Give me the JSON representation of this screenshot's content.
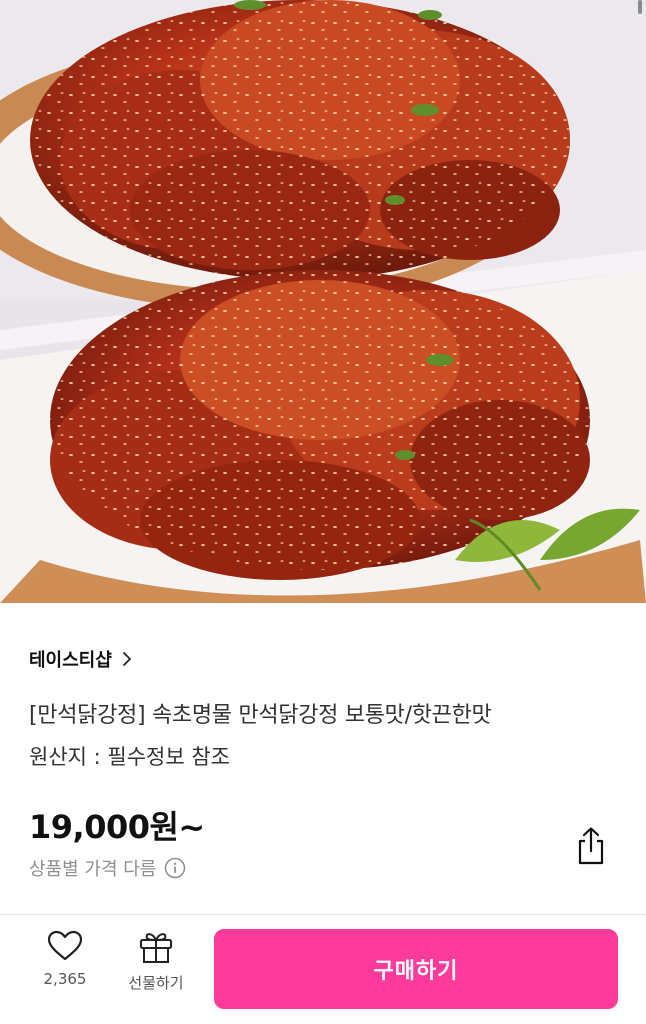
{
  "product_image": {
    "icon": "fried-chicken-photo"
  },
  "store": {
    "name": "테이스티샵",
    "chevron_icon": "chevron-right-icon"
  },
  "product": {
    "title": "[만석닭강정] 속초명물 만석닭강정 보통맛/핫끈한맛",
    "origin": "원산지 : 필수정보 참조",
    "price": "19,000원~",
    "price_note": "상품별 가격 다름",
    "info_icon": "info-icon",
    "share_icon": "share-icon"
  },
  "bottom_bar": {
    "like_count": "2,365",
    "like_icon": "heart-icon",
    "gift_label": "선물하기",
    "gift_icon": "gift-icon",
    "buy_label": "구매하기"
  },
  "colors": {
    "accent": "#fe3a9a",
    "muted_text": "#8e8e93",
    "divider": "#e7e7e7"
  }
}
